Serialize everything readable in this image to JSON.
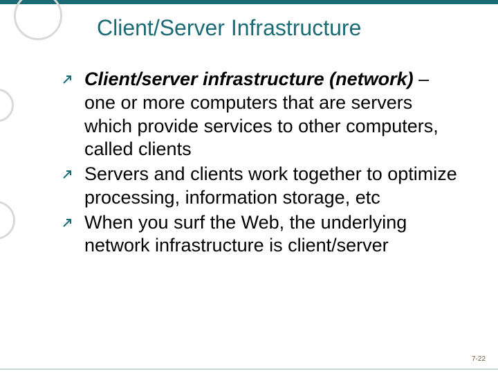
{
  "slide": {
    "title": "Client/Server Infrastructure",
    "bullets": [
      {
        "emph": "Client/server infrastructure (network)",
        "rest": " – one or more computers that are servers which provide services to other computers, called clients"
      },
      {
        "emph": "",
        "rest": "Servers and clients work together to optimize processing, information storage, etc"
      },
      {
        "emph": "",
        "rest": "When you surf the Web, the underlying network infrastructure is client/server"
      }
    ],
    "page_number": "7-22"
  }
}
